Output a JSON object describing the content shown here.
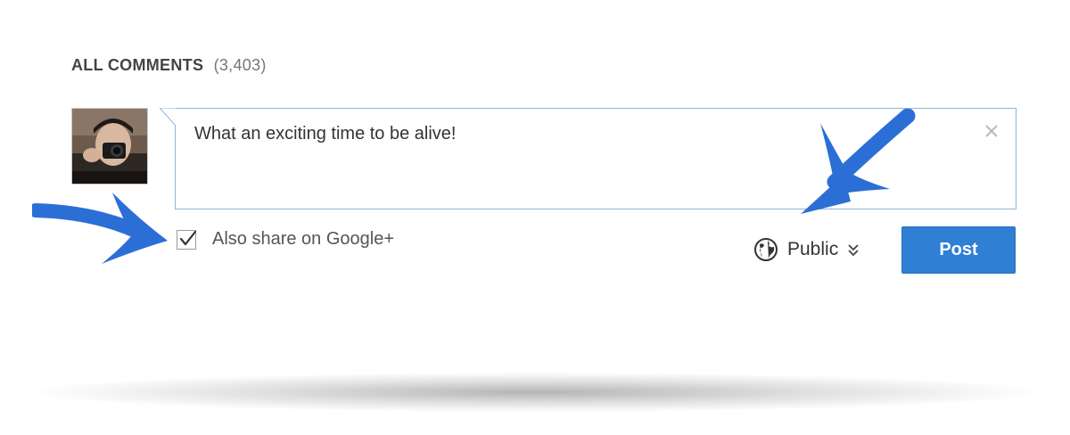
{
  "header": {
    "title": "ALL COMMENTS",
    "count": "(3,403)"
  },
  "comment": {
    "text": "What an exciting time to be alive!",
    "close_glyph": "×"
  },
  "share": {
    "checked": true,
    "label": "Also share on Google+"
  },
  "visibility": {
    "label": "Public",
    "icon": "globe-icon"
  },
  "post": {
    "label": "Post"
  },
  "colors": {
    "accent": "#2f7fd5",
    "arrow": "#2b6fd6",
    "box_border": "#8fb3d9"
  }
}
